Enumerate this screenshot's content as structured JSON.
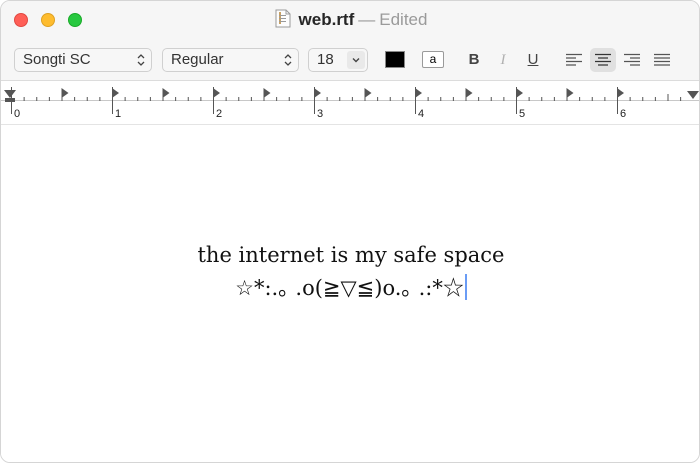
{
  "window": {
    "filename": "web.rtf",
    "separator": "—",
    "status": "Edited"
  },
  "toolbar": {
    "font_family": "Songti SC",
    "font_style": "Regular",
    "font_size": "18",
    "text_color": "#000000",
    "highlight_label": "a",
    "bold_label": "B",
    "italic_label": "I",
    "underline_label": "U"
  },
  "ruler": {
    "numbers": [
      "0",
      "1",
      "2",
      "3",
      "4",
      "5",
      "6"
    ]
  },
  "document": {
    "line1": "the internet is my safe space",
    "line2": "☆*:.｡ .o(≧▽≦)o.｡ .:*☆"
  }
}
